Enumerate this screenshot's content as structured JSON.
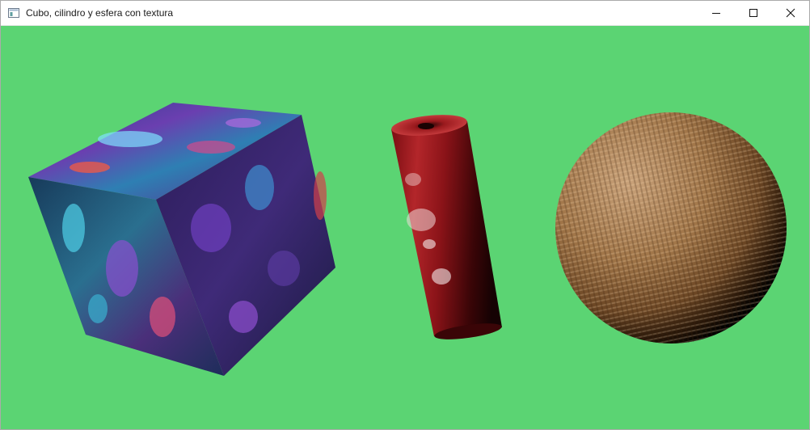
{
  "window": {
    "title": "Cubo, cilindro y esfera con textura",
    "app_icon": "window-app-icon",
    "controls": {
      "minimize_icon": "minimize-icon",
      "maximize_icon": "maximize-icon",
      "close_icon": "close-icon"
    }
  },
  "colors": {
    "background": "#5bd473",
    "titlebar": "#ffffff"
  },
  "scene": {
    "objects": [
      {
        "name": "cube",
        "texture": "psychedelic blue-purple-red"
      },
      {
        "name": "cylinder",
        "texture": "red marbled"
      },
      {
        "name": "sphere",
        "texture": "burlap weave"
      }
    ]
  }
}
